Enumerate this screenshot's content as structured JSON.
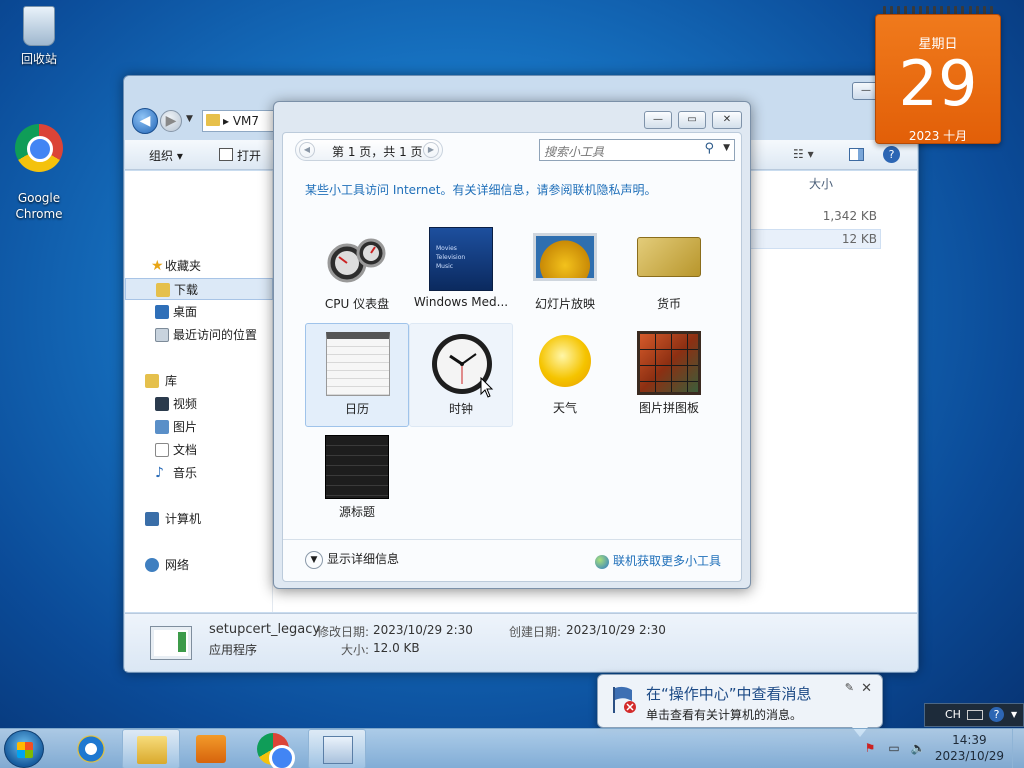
{
  "desktop": {
    "icons": [
      {
        "label": "回收站",
        "icon": "recycle-bin-icon"
      },
      {
        "label": "Google\nChrome",
        "icon": "chrome-icon"
      }
    ]
  },
  "explorer": {
    "address": "VM7",
    "toolbar": {
      "organize": "组织 ▾",
      "open": "打开"
    },
    "nav": {
      "favorites": "收藏夹",
      "downloads": "下载",
      "desktop": "桌面",
      "recent": "最近访问的位置",
      "libraries": "库",
      "videos": "视频",
      "pictures": "图片",
      "documents": "文档",
      "music": "音乐",
      "computer": "计算机",
      "network": "网络"
    },
    "column_size": "大小",
    "sizes": [
      "1,342 KB",
      "12 KB"
    ],
    "details": {
      "name": "setupcert_legacy",
      "type": "应用程序",
      "modified_label": "修改日期:",
      "modified": "2023/10/29 2:30",
      "created_label": "创建日期:",
      "created": "2023/10/29 2:30",
      "size_label": "大小:",
      "size": "12.0 KB"
    }
  },
  "gallery": {
    "page_text": "第 1 页，共 1 页",
    "search_placeholder": "搜索小工具",
    "notice": "某些小工具访问 Internet。有关详细信息，请参阅联机隐私声明。",
    "gadgets": [
      {
        "label": "CPU 仪表盘",
        "icon": "cpu-meter-icon"
      },
      {
        "label": "Windows Med...",
        "icon": "media-center-icon"
      },
      {
        "label": "幻灯片放映",
        "icon": "slideshow-icon"
      },
      {
        "label": "货币",
        "icon": "currency-icon"
      },
      {
        "label": "日历",
        "icon": "calendar-icon"
      },
      {
        "label": "时钟",
        "icon": "clock-icon"
      },
      {
        "label": "天气",
        "icon": "weather-icon"
      },
      {
        "label": "图片拼图板",
        "icon": "picture-puzzle-icon"
      },
      {
        "label": "源标题",
        "icon": "feed-headlines-icon"
      }
    ],
    "show_details": "显示详细信息",
    "get_more": "联机获取更多小工具",
    "media_center_lines": [
      "Movies",
      "Television",
      "Music"
    ]
  },
  "calendar_gadget": {
    "weekday": "星期日",
    "day": "29",
    "year_month": "2023 十月"
  },
  "balloon": {
    "title": "在“操作中心”中查看消息",
    "body": "单击查看有关计算机的消息。"
  },
  "langbar": {
    "lang": "CH"
  },
  "taskbar": {
    "time": "14:39",
    "date": "2023/10/29"
  },
  "colors": {
    "accent": "#1f6fb9",
    "calendar_orange": "#e8670f",
    "selection": "#dce9f7"
  }
}
